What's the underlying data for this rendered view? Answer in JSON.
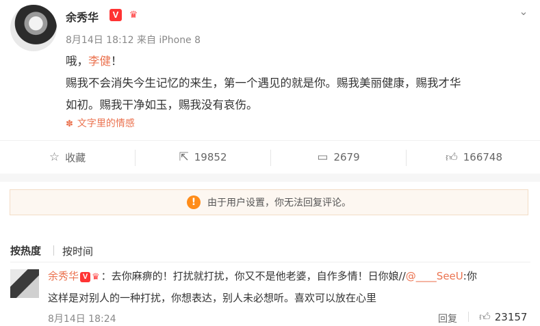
{
  "post": {
    "author": "余秀华",
    "vip_badge": "V",
    "meta": "8月14日 18:12 来自 iPhone 8",
    "line1_prefix": "哦，",
    "line1_mention": "李健",
    "line1_suffix": "！",
    "line2": "赐我不会消失今生记忆的来生，第一个遇见的就是你。赐我美丽健康，赐我才华",
    "line3": "如初。赐我干净如玉，赐我没有哀伤。",
    "topic": "文字里的情感"
  },
  "actions": {
    "favorite_label": "收藏",
    "share_count": "19852",
    "comment_count": "2679",
    "like_count": "166748"
  },
  "notice": {
    "text": "由于用户设置，你无法回复评论。"
  },
  "sort_tabs": {
    "hot": "按热度",
    "time": "按时间"
  },
  "comment": {
    "author": "余秀华",
    "vip_badge": "V",
    "text_a": "：去你麻痹的！打扰就打扰，你又不是他老婆，自作多情！日你娘//",
    "mention": "@____SeeU",
    "text_b": ":你",
    "line2": "这样是对别人的一种打扰，你想表达，别人未必想听。喜欢可以放在心里",
    "time": "8月14日 18:24",
    "reply_label": "回复",
    "like_count": "23157"
  },
  "colors": {
    "link": "#eb7350",
    "badge": "#ff3333",
    "warning": "#ff8c19"
  }
}
